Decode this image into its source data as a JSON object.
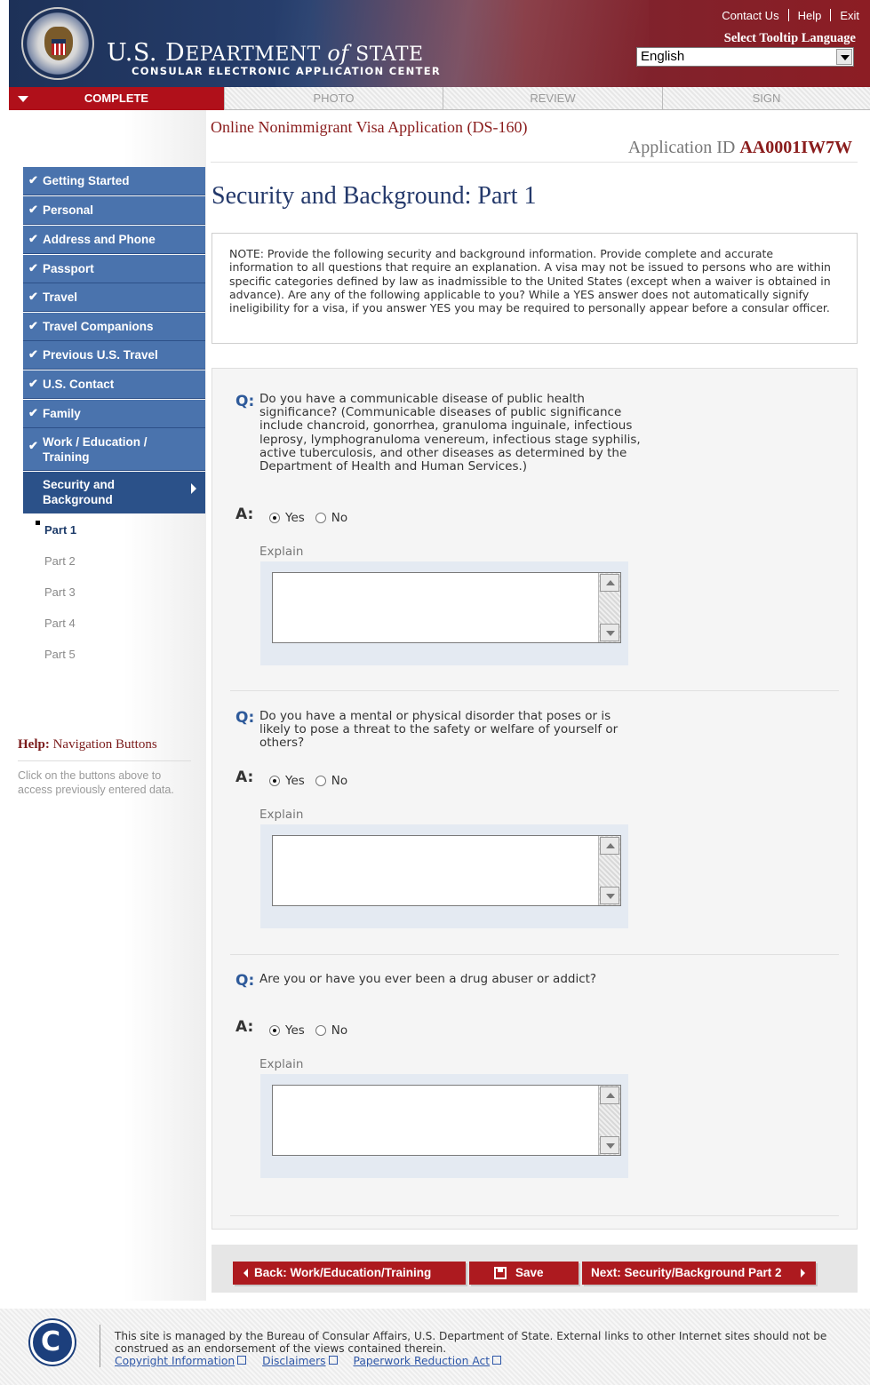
{
  "header": {
    "dept_title_prefix": "U.S. D",
    "dept_title_main": "EPARTMENT ",
    "dept_title_of": "of",
    "dept_title_state": " STATE",
    "subtitle": "CONSULAR ELECTRONIC APPLICATION CENTER",
    "links": [
      "Contact Us",
      "Help",
      "Exit"
    ],
    "tooltip_label": "Select Tooltip Language",
    "language_selected": "English"
  },
  "steps": [
    "COMPLETE",
    "PHOTO",
    "REVIEW",
    "SIGN"
  ],
  "sidebar": {
    "items": [
      "Getting Started",
      "Personal",
      "Address and Phone",
      "Passport",
      "Travel",
      "Travel Companions",
      "Previous U.S. Travel",
      "U.S. Contact",
      "Family",
      "Work / Education / Training"
    ],
    "current_section": "Security and Background",
    "subitems": [
      "Part 1",
      "Part 2",
      "Part 3",
      "Part 4",
      "Part 5"
    ],
    "help_title_bold": "Help:",
    "help_title_rest": " Navigation Buttons",
    "help_text": "Click on the buttons above to access previously entered data."
  },
  "main": {
    "app_title": "Online Nonimmigrant Visa Application (DS-160)",
    "app_id_label": "Application ID ",
    "app_id": "AA0001IW7W",
    "page_title": "Security and Background: Part 1",
    "note": "NOTE: Provide the following security and background information. Provide complete and accurate information to all questions that require an explanation. A visa may not be issued to persons who are within specific categories defined by law as inadmissible to the United States (except when a waiver is obtained in advance). Are any of the following applicable to you? While a YES answer does not automatically signify ineligibility for a visa, if you answer YES you may be required to personally appear before a consular officer.",
    "q_label": "Q:",
    "a_label": "A:",
    "yes_label": "Yes",
    "no_label": "No",
    "explain_label": "Explain",
    "questions": [
      {
        "text": "Do you have a communicable disease of public health significance? (Communicable diseases of public significance include chancroid, gonorrhea, granuloma inguinale, infectious leprosy, lymphogranuloma venereum, infectious stage syphilis, active tuberculosis, and other diseases as determined by the Department of Health and Human Services.)",
        "answer": "Yes"
      },
      {
        "text": "Do you have a mental or physical disorder that poses or is likely to pose a threat to the safety or welfare of yourself or others?",
        "answer": "Yes"
      },
      {
        "text": "Are you or have you ever been a drug abuser or addict?",
        "answer": "Yes"
      }
    ]
  },
  "buttons": {
    "back": "Back: Work/Education/Training",
    "save": "Save",
    "next": "Next: Security/Background Part 2"
  },
  "footer": {
    "text": "This site is managed by the Bureau of Consular Affairs, U.S. Department of State. External links to other Internet sites should not be construed as an endorsement of the views contained therein.",
    "links": [
      "Copyright Information",
      "Disclaimers",
      "Paperwork Reduction Act"
    ]
  },
  "colors": {
    "brand_navy": "#1d3158",
    "brand_red": "#ad1a1f",
    "nav_blue": "#4a73ad",
    "link_blue": "#2e57a8"
  }
}
